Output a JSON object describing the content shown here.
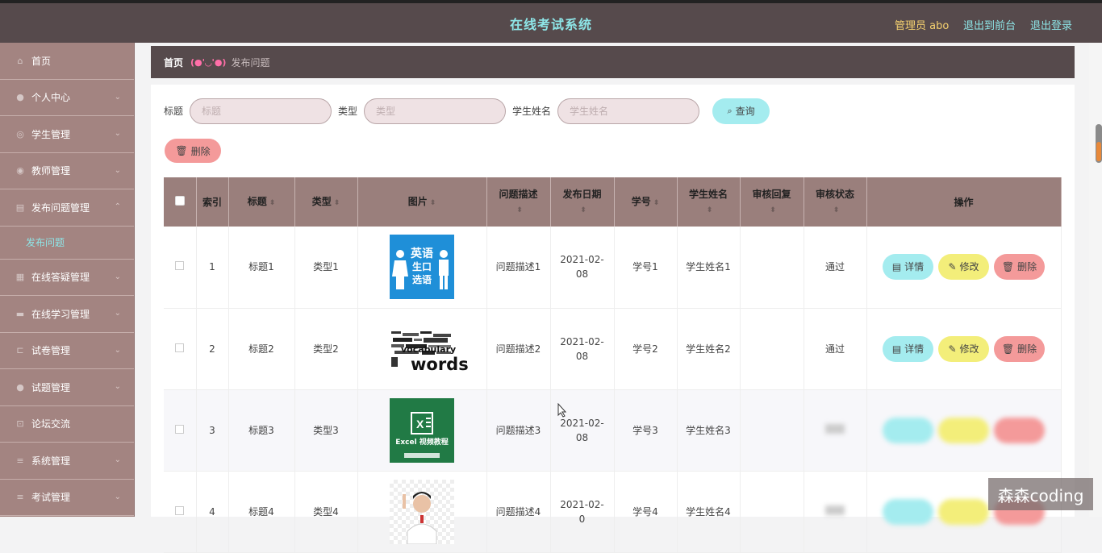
{
  "header": {
    "title": "在线考试系统",
    "admin": "管理员 abo",
    "link_front": "退出到前台",
    "link_logout": "退出登录"
  },
  "sidebar": {
    "items": [
      {
        "label": "首页",
        "icon": "home-icon"
      },
      {
        "label": "个人中心",
        "icon": "user-icon"
      },
      {
        "label": "学生管理",
        "icon": "student-icon"
      },
      {
        "label": "教师管理",
        "icon": "teacher-icon"
      },
      {
        "label": "发布问题管理",
        "icon": "question-icon"
      },
      {
        "label": "发布问题",
        "icon": ""
      },
      {
        "label": "在线答疑管理",
        "icon": "answer-icon"
      },
      {
        "label": "在线学习管理",
        "icon": "study-icon"
      },
      {
        "label": "试卷管理",
        "icon": "paper-icon"
      },
      {
        "label": "试题管理",
        "icon": "test-icon"
      },
      {
        "label": "论坛交流",
        "icon": "forum-icon"
      },
      {
        "label": "系统管理",
        "icon": "system-icon"
      },
      {
        "label": "考试管理",
        "icon": "exam-icon"
      }
    ]
  },
  "breadcrumb": {
    "home": "首页",
    "sep": "(●'◡'●)",
    "current": "发布问题"
  },
  "search": {
    "title_label": "标题",
    "title_placeholder": "标题",
    "type_label": "类型",
    "type_placeholder": "类型",
    "name_label": "学生姓名",
    "name_placeholder": "学生姓名",
    "query_label": "查询",
    "delete_label": "删除"
  },
  "table": {
    "headers": {
      "index": "索引",
      "title": "标题",
      "type": "类型",
      "image": "图片",
      "desc": "问题描述",
      "date": "发布日期",
      "sid": "学号",
      "name": "学生姓名",
      "reply": "审核回复",
      "status": "审核状态",
      "ops": "操作"
    },
    "rows": [
      {
        "index": "1",
        "title": "标题1",
        "type": "类型1",
        "desc": "问题描述1",
        "date": "2021-02-08",
        "sid": "学号1",
        "name": "学生姓名1",
        "reply": "",
        "status": "通过"
      },
      {
        "index": "2",
        "title": "标题2",
        "type": "类型2",
        "desc": "问题描述2",
        "date": "2021-02-08",
        "sid": "学号2",
        "name": "学生姓名2",
        "reply": "",
        "status": "通过"
      },
      {
        "index": "3",
        "title": "标题3",
        "type": "类型3",
        "desc": "问题描述3",
        "date": "2021-02-08",
        "sid": "学号3",
        "name": "学生姓名3",
        "reply": "",
        "status": ""
      },
      {
        "index": "4",
        "title": "标题4",
        "type": "类型4",
        "desc": "问题描述4",
        "date": "2021-02-0",
        "sid": "学号4",
        "name": "学生姓名4",
        "reply": "",
        "status": ""
      }
    ],
    "ops": {
      "detail": "详情",
      "edit": "修改",
      "delete": "删除"
    },
    "images": {
      "img1_line1": "英语",
      "img1_line2": "生口",
      "img1_line3": "选语",
      "img2_word": "words",
      "img2_word2": "vocabulary",
      "img3_line1": "Excel 视频教程"
    }
  },
  "watermark": "森森coding"
}
